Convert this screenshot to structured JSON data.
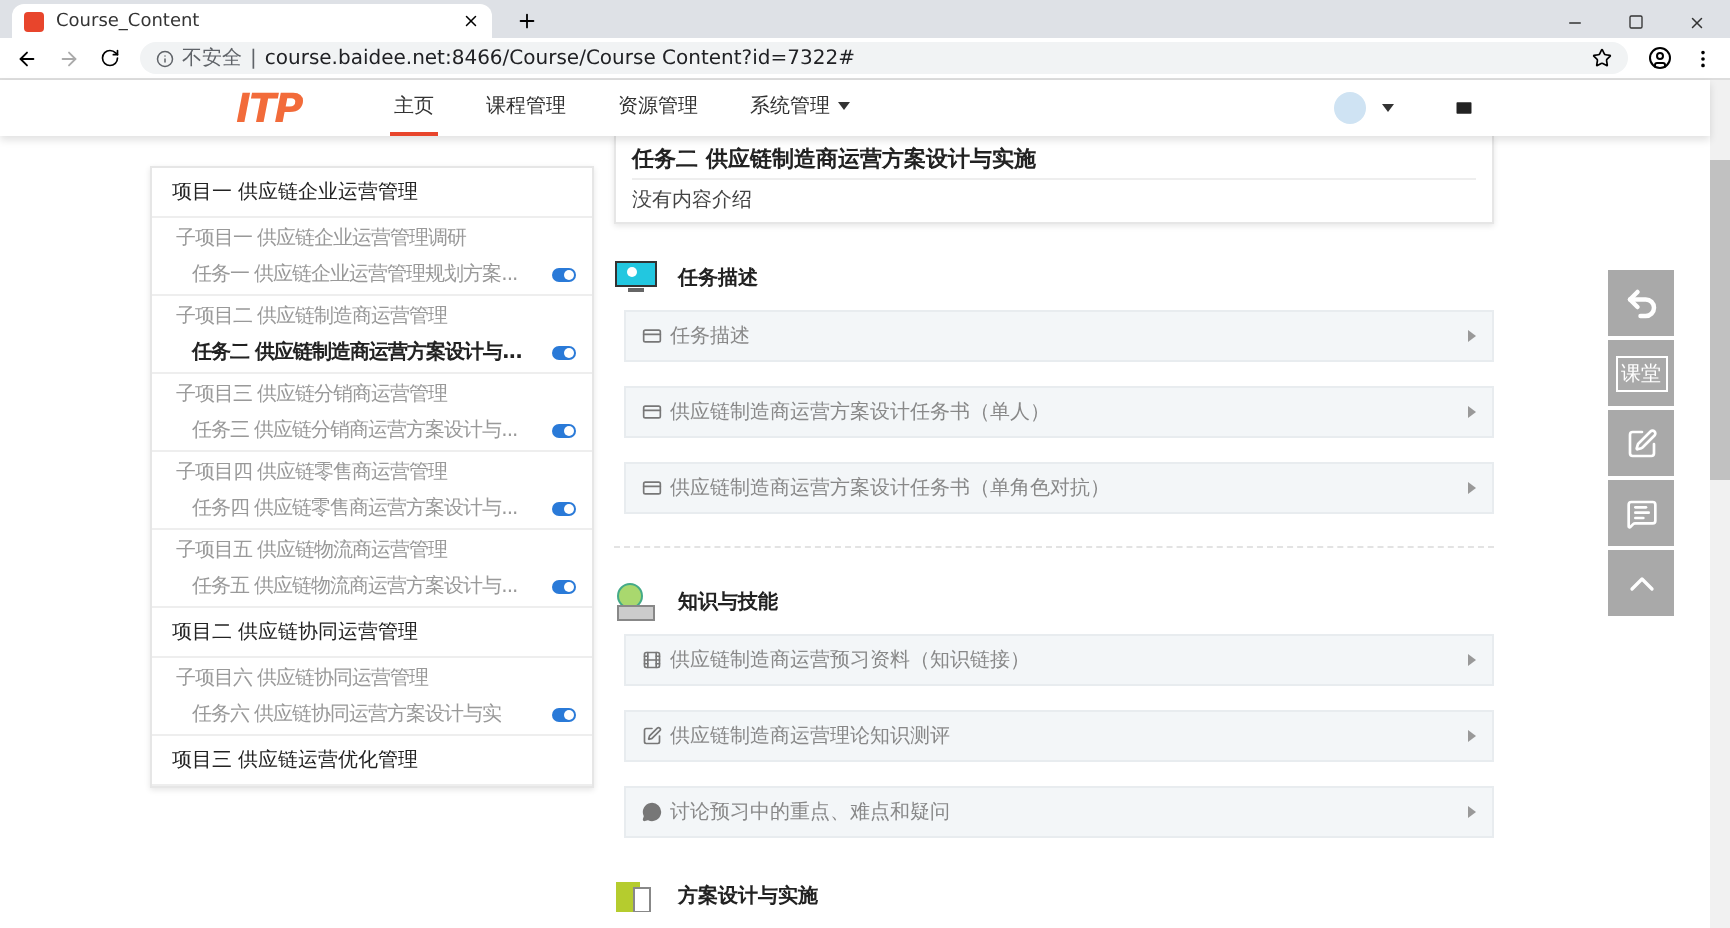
{
  "browser": {
    "tab_title": "Course_Content",
    "security": "不安全",
    "separator": "|",
    "url": "course.baidee.net:8466/Course/Course Content?id=7322#"
  },
  "header": {
    "logo": "ITP",
    "nav": [
      {
        "label": "主页",
        "selected": true,
        "dropdown": false
      },
      {
        "label": "课程管理",
        "selected": false,
        "dropdown": false
      },
      {
        "label": "资源管理",
        "selected": false,
        "dropdown": false
      },
      {
        "label": "系统管理",
        "selected": false,
        "dropdown": true
      }
    ]
  },
  "sidebar": {
    "projects": [
      {
        "title": "项目一 供应链企业运营管理",
        "children": [
          {
            "title": "子项目一 供应链企业运营管理调研",
            "children": [
              {
                "label": "任务一 供应链企业运营管理规划方案...",
                "selected": false,
                "on": true
              }
            ]
          },
          {
            "title": "子项目二 供应链制造商运营管理",
            "children": [
              {
                "label": "任务二 供应链制造商运营方案设计与...",
                "selected": true,
                "on": true
              }
            ]
          },
          {
            "title": "子项目三 供应链分销商运营管理",
            "children": [
              {
                "label": "任务三 供应链分销商运营方案设计与...",
                "selected": false,
                "on": true
              }
            ]
          },
          {
            "title": "子项目四 供应链零售商运营管理",
            "children": [
              {
                "label": "任务四 供应链零售商运营方案设计与...",
                "selected": false,
                "on": true
              }
            ]
          },
          {
            "title": "子项目五 供应链物流商运营管理",
            "children": [
              {
                "label": "任务五 供应链物流商运营方案设计与...",
                "selected": false,
                "on": true
              }
            ]
          }
        ]
      },
      {
        "title": "项目二 供应链协同运营管理",
        "children": [
          {
            "title": "子项目六 供应链协同运营管理",
            "children": [
              {
                "label": "任务六 供应链协同运营方案设计与实",
                "selected": false,
                "on": true
              }
            ]
          }
        ]
      },
      {
        "title": "项目三 供应链运营优化管理"
      }
    ]
  },
  "task_card": {
    "title": "任务二 供应链制造商运营方案设计与实施",
    "description": "没有内容介绍"
  },
  "sections": [
    {
      "kind": "task",
      "title": "任务描述",
      "items": [
        {
          "kind": "document",
          "label": "任务描述"
        },
        {
          "kind": "document",
          "label": "供应链制造商运营方案设计任务书（单人）"
        },
        {
          "kind": "document",
          "label": "供应链制造商运营方案设计任务书（单角色对抗）"
        }
      ]
    },
    {
      "kind": "knowledge",
      "title": "知识与技能",
      "items": [
        {
          "kind": "material",
          "label": "供应链制造商运营预习资料（知识链接）"
        },
        {
          "kind": "quiz",
          "label": "供应链制造商运营理论知识测评"
        },
        {
          "kind": "discussion",
          "label": "讨论预习中的重点、难点和疑问"
        }
      ]
    },
    {
      "kind": "design",
      "title": "方案设计与实施"
    }
  ],
  "float_buttons": [
    {
      "kind": "back"
    },
    {
      "kind": "classroom",
      "label": "课堂"
    },
    {
      "kind": "edit"
    },
    {
      "kind": "comment"
    },
    {
      "kind": "top"
    }
  ]
}
